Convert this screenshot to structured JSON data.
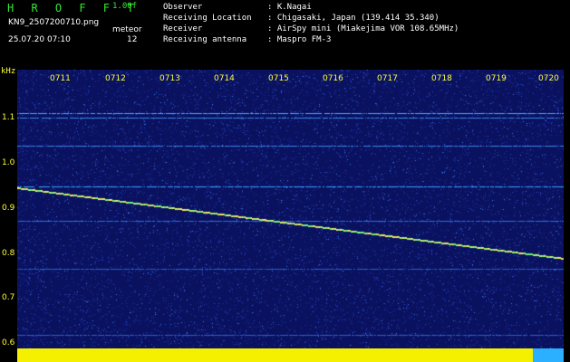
{
  "header": {
    "app_name": "H R O F F T",
    "version": "1.00f",
    "filename": "KN9_2507200710.png",
    "mode": "meteor",
    "timestamp": "25.07.20 07:10",
    "count": "12"
  },
  "meta": [
    {
      "key": "Observer",
      "value": ": K.Nagai"
    },
    {
      "key": "Receiving Location",
      "value": ": Chigasaki, Japan (139.414 35.340)"
    },
    {
      "key": "Receiver",
      "value": ": AirSpy mini (Miakejima VOR 108.65MHz)"
    },
    {
      "key": "Receiving antenna",
      "value": ": Maspro FM-3"
    }
  ],
  "y_axis_label": "kHz",
  "y_ticks": [
    "1.1",
    "1.0",
    "0.9",
    "0.8",
    "0.7",
    "0.6"
  ],
  "x_ticks": [
    "0711",
    "0712",
    "0713",
    "0714",
    "0715",
    "0716",
    "0717",
    "0718",
    "0719",
    "0720"
  ],
  "colors": {
    "background": "#000000",
    "plot_bg": "#0a1260",
    "title_green": "#33e833",
    "tick_yellow": "#ffff33",
    "bar_yellow": "#f4f000",
    "bar_blue": "#2ab0ff"
  }
}
